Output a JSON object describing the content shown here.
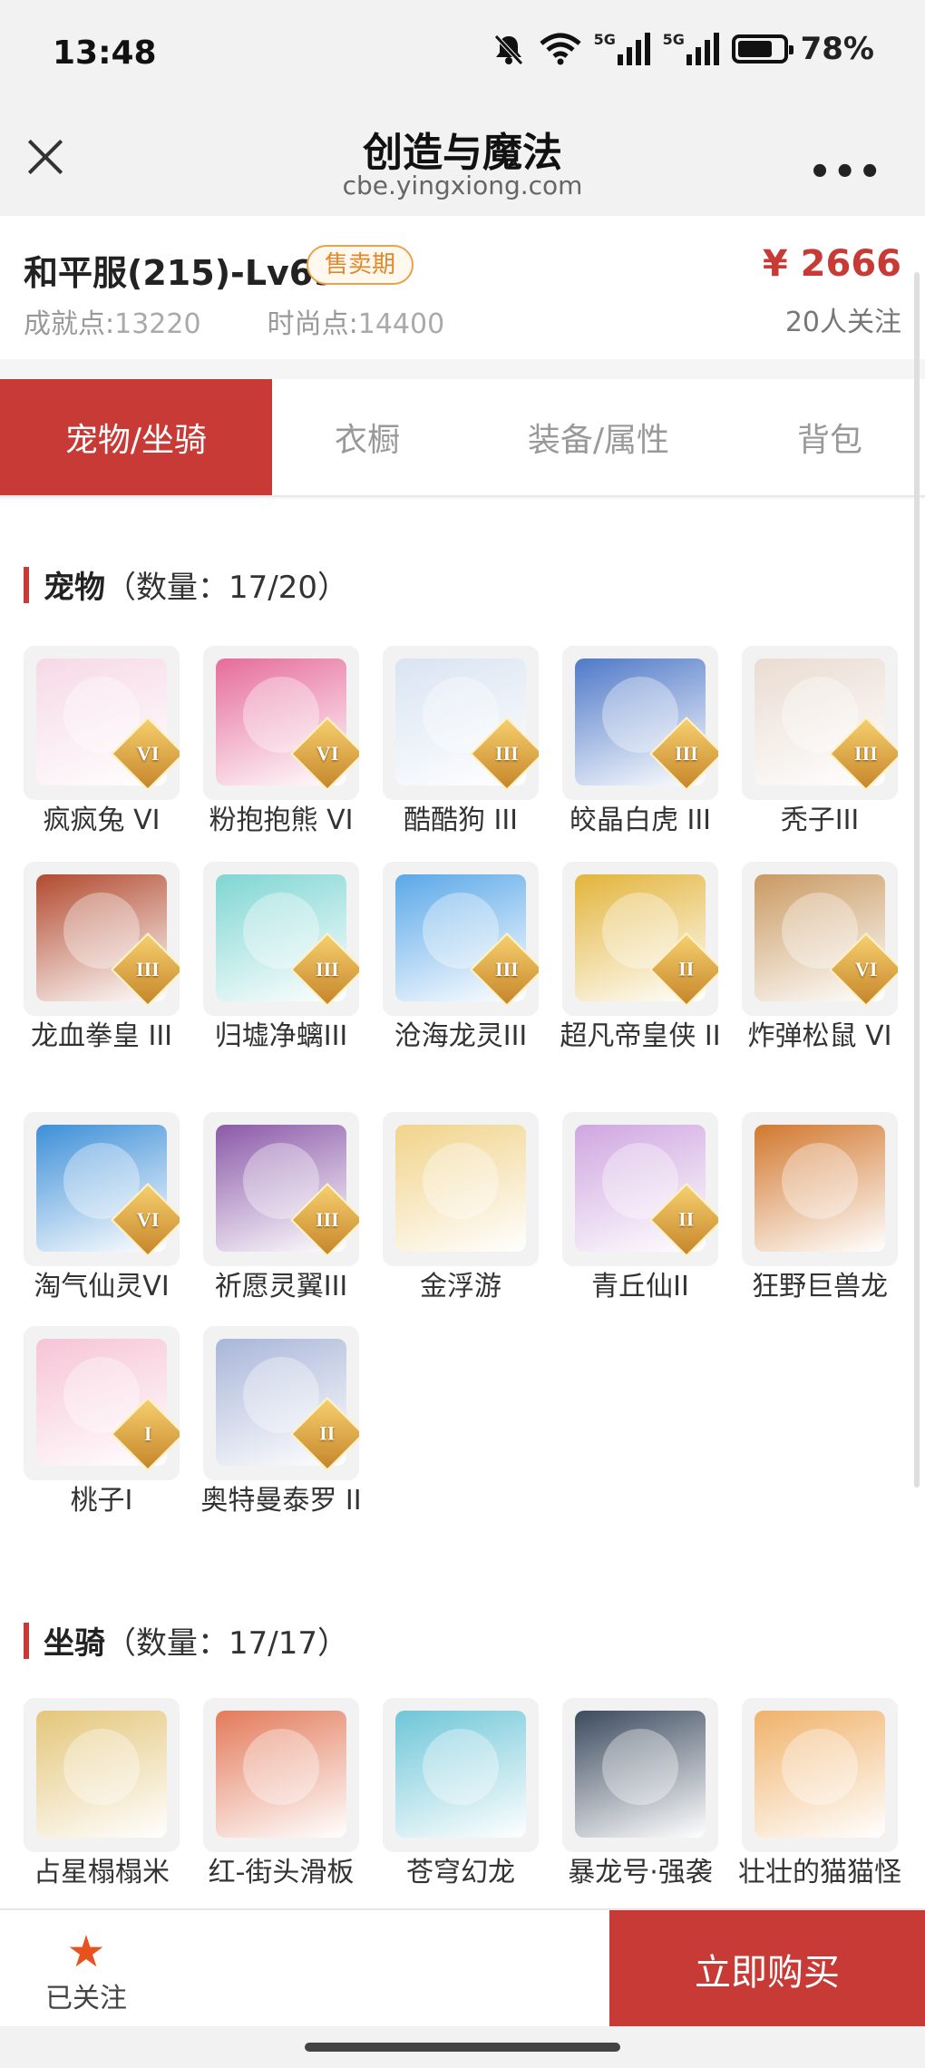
{
  "status": {
    "time": "13:48",
    "battery_pct": "78%",
    "net1": "5G",
    "net2": "5G",
    "battery_level": 0.78
  },
  "titlebar": {
    "title": "创造与魔法",
    "url": "cbe.yingxiong.com",
    "more": "•••"
  },
  "info": {
    "server_level": "和平服(215)-Lv69",
    "badge": "售卖期",
    "achievement_label": "成就点:",
    "achievement_value": "13220",
    "fashion_label": "时尚点:",
    "fashion_value": "14400",
    "price": "¥ 2666",
    "followers": "20人关注"
  },
  "tabs": [
    "宠物/坐骑",
    "衣橱",
    "装备/属性",
    "背包"
  ],
  "active_tab": 0,
  "pets": {
    "title": "宠物",
    "count": "（数量：17/20）",
    "items": [
      {
        "label": "疯疯兔 VI",
        "rank": "VI",
        "icon": "bunny-pet-icon",
        "color": "#f6d9e6"
      },
      {
        "label": "粉抱抱熊 VI",
        "rank": "VI",
        "icon": "pink-bear-pet-icon",
        "color": "#e66c9a"
      },
      {
        "label": "酷酷狗 III",
        "rank": "III",
        "icon": "cool-dog-pet-icon",
        "color": "#d9e4f2"
      },
      {
        "label": "皎晶白虎 III",
        "rank": "III",
        "icon": "white-tiger-pet-icon",
        "color": "#4f79c8"
      },
      {
        "label": "秃子III",
        "rank": "III",
        "icon": "bald-pet-icon",
        "color": "#eadcd2"
      },
      {
        "label": "龙血拳皇 III",
        "rank": "III",
        "icon": "dragon-blood-pet-icon",
        "color": "#b24a2f"
      },
      {
        "label": "归墟净螭III",
        "rank": "III",
        "icon": "cyan-dragon-pet-icon",
        "color": "#7fd6d3"
      },
      {
        "label": "沧海龙灵III",
        "rank": "III",
        "icon": "sea-dragon-spirit-pet-icon",
        "color": "#5aa8e8"
      },
      {
        "label": "超凡帝皇侠 II",
        "rank": "II",
        "icon": "golden-emperor-pet-icon",
        "color": "#e2b43a"
      },
      {
        "label": "炸弹松鼠 VI",
        "rank": "VI",
        "icon": "bomb-squirrel-pet-icon",
        "color": "#c99a62"
      },
      {
        "label": "淘气仙灵VI",
        "rank": "VI",
        "icon": "blue-puppy-pet-icon",
        "color": "#3d8fd8"
      },
      {
        "label": "祈愿灵翼III",
        "rank": "III",
        "icon": "eagle-pet-icon",
        "color": "#8b59a8"
      },
      {
        "label": "金浮游",
        "rank": "",
        "icon": "golden-wisp-pet-icon",
        "color": "#f1d38a"
      },
      {
        "label": "青丘仙II",
        "rank": "II",
        "icon": "fox-fairy-pet-icon",
        "color": "#cfa6e0"
      },
      {
        "label": "狂野巨兽龙",
        "rank": "",
        "icon": "wild-dino-pet-icon",
        "color": "#d2782f"
      },
      {
        "label": "桃子I",
        "rank": "I",
        "icon": "pink-cat-pet-icon",
        "color": "#f6c4d6"
      },
      {
        "label": "奥特曼泰罗 II",
        "rank": "II",
        "icon": "ultraman-pet-icon",
        "color": "#a9b6d8"
      }
    ]
  },
  "mounts": {
    "title": "坐骑",
    "count": "（数量：17/17）",
    "items": [
      {
        "label": "占星榻榻米",
        "icon": "astrology-tatami-mount-icon",
        "color": "#e4c67a"
      },
      {
        "label": "红-街头滑板",
        "icon": "skateboard-mount-icon",
        "color": "#e37a5a"
      },
      {
        "label": "苍穹幻龙",
        "icon": "sky-dragon-mount-icon",
        "color": "#6ec6d8"
      },
      {
        "label": "暴龙号·强袭",
        "icon": "mech-dino-mount-icon",
        "color": "#3b4a5e"
      },
      {
        "label": "壮壮的猫猫怪",
        "icon": "big-cat-mount-icon",
        "color": "#f0b26a"
      }
    ]
  },
  "bottom": {
    "fav_label": "已关注",
    "star": "★",
    "buy_label": "立即购买"
  }
}
